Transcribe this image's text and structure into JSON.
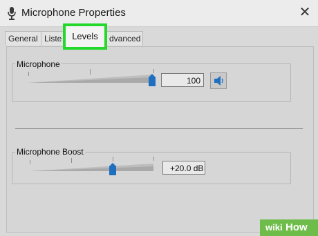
{
  "window": {
    "title": "Microphone Properties",
    "close_glyph": "✕"
  },
  "tabs": [
    {
      "label": "General"
    },
    {
      "label": "Liste"
    },
    {
      "label": "Levels",
      "selected": true
    },
    {
      "label": "dvanced"
    }
  ],
  "highlight_color": "#22d92b",
  "levels": {
    "microphone": {
      "label": "Microphone",
      "value": "100",
      "fraction": 1.0,
      "mute_icon": "speaker-icon"
    },
    "boost": {
      "label": "Microphone Boost",
      "value": "+20.0 dB",
      "fraction": 0.67
    }
  },
  "watermark": {
    "light": "wiki",
    "bold": "How"
  }
}
